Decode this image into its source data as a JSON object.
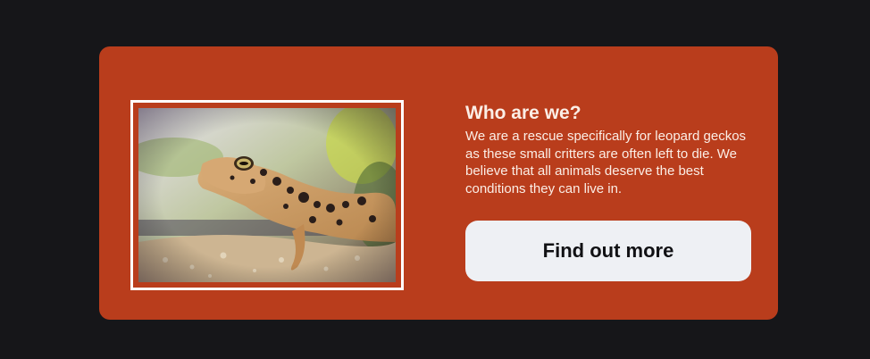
{
  "card": {
    "accent_color": "#b93d1c",
    "heading": "Who are we?",
    "description": "We are a rescue specifically for leopard geckos as these small critters are often left to die. We believe that all animals deserve the best conditions they can live in.",
    "image_subject": "leopard-gecko-photo",
    "cta_label": "Find out more"
  }
}
